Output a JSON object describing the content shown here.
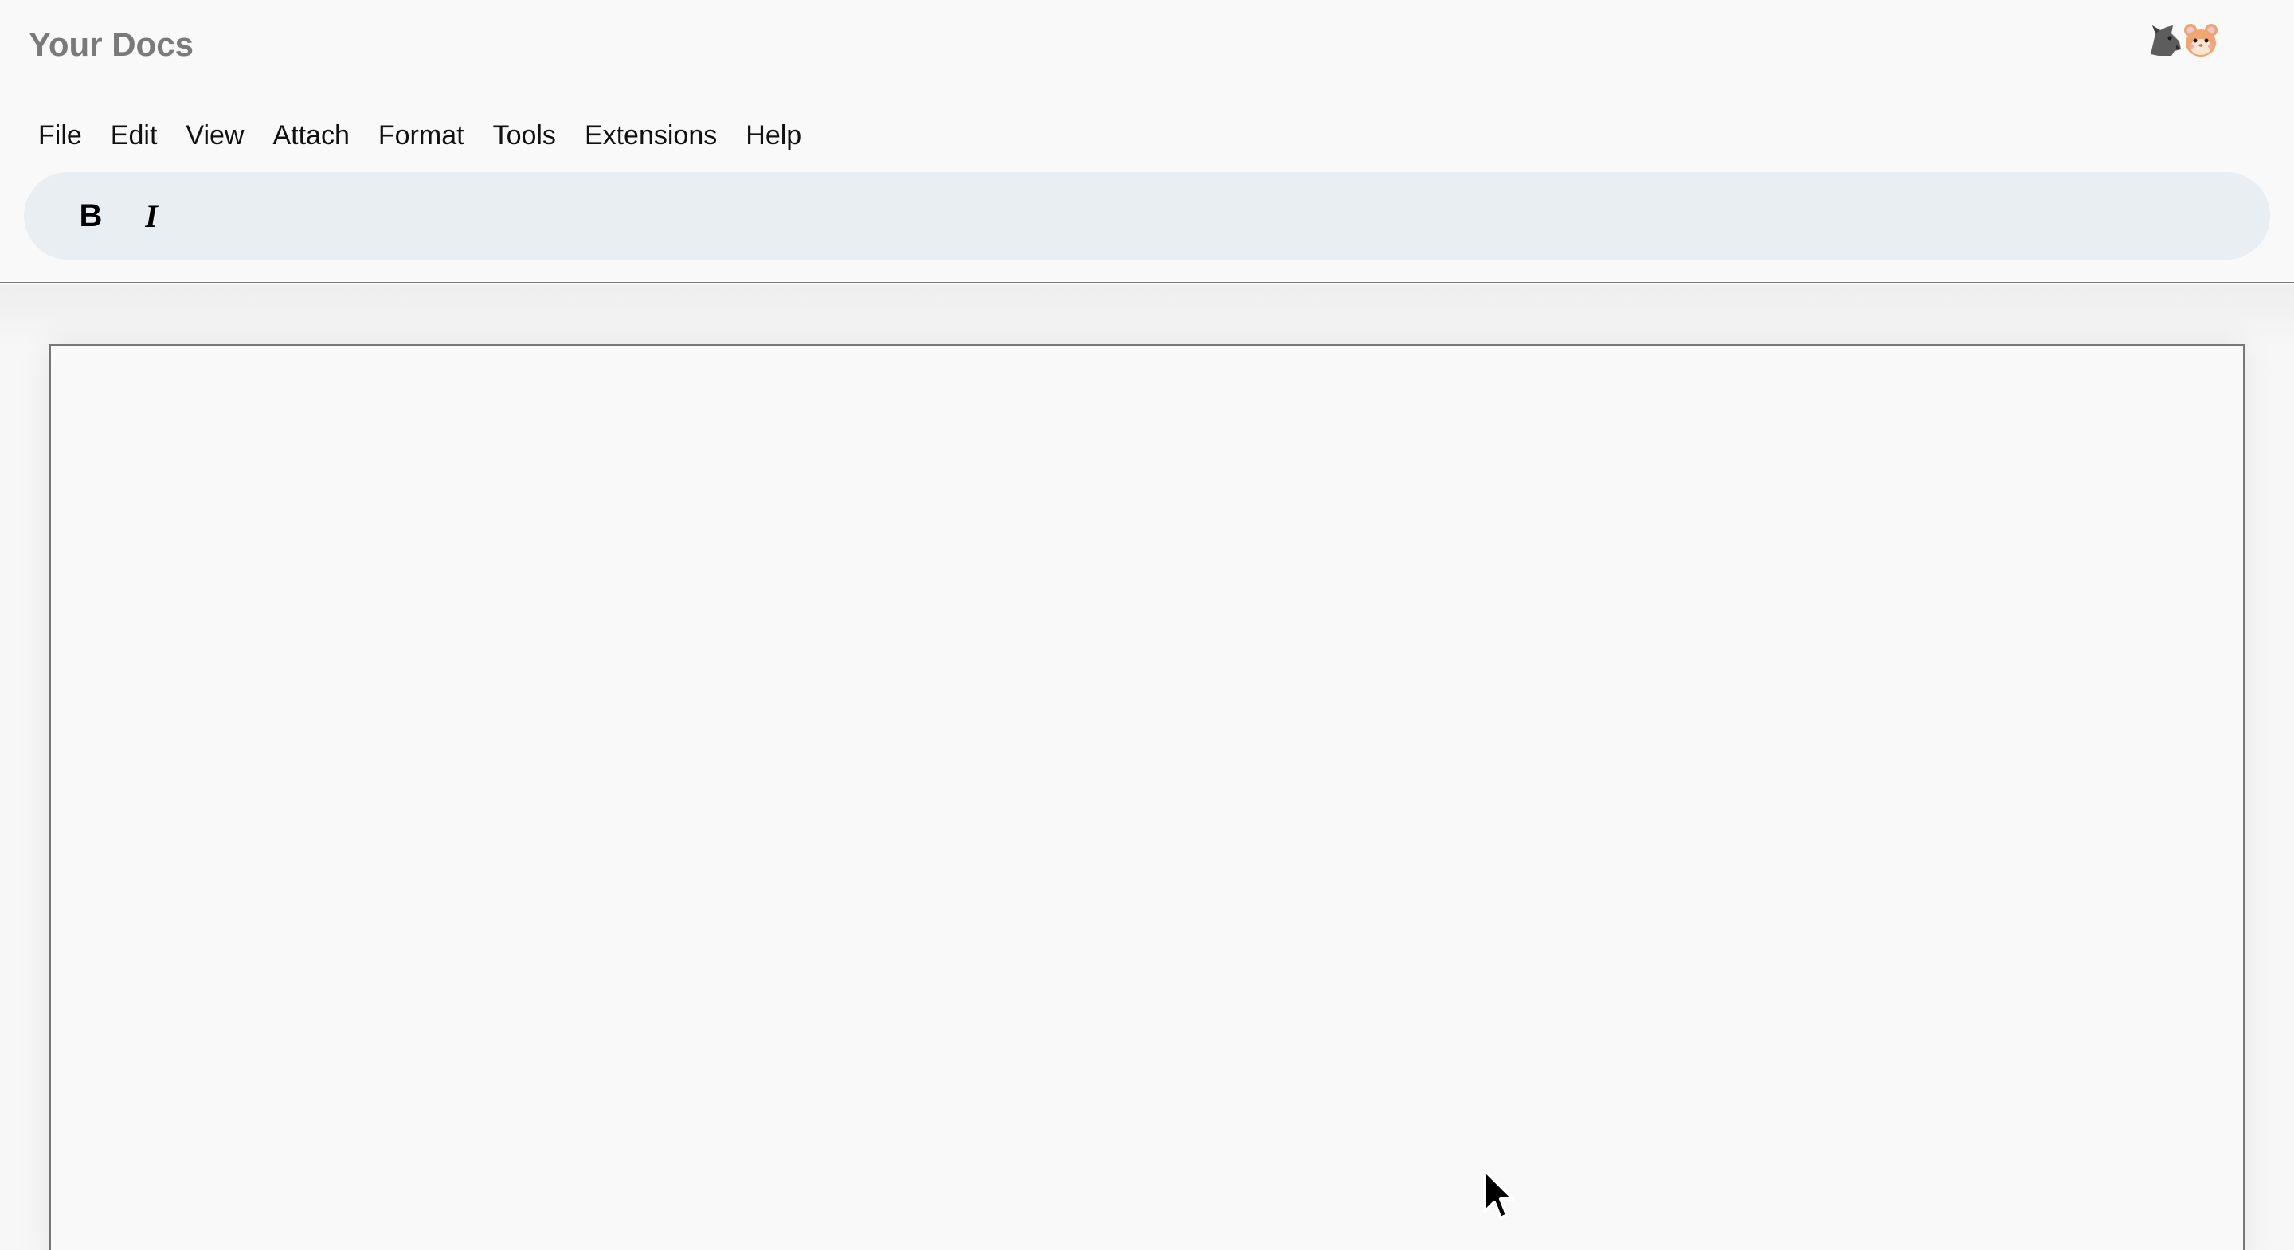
{
  "app": {
    "title": "Your Docs"
  },
  "collaborators": [
    {
      "name": "wolf-avatar",
      "icon": "wolf-icon"
    },
    {
      "name": "hamster-avatar",
      "icon": "hamster-icon"
    }
  ],
  "menubar": {
    "items": [
      "File",
      "Edit",
      "View",
      "Attach",
      "Format",
      "Tools",
      "Extensions",
      "Help"
    ]
  },
  "toolbar": {
    "bold_label": "B",
    "italic_label": "I"
  },
  "document": {
    "content": ""
  },
  "colors": {
    "toolbar_bg": "#e9eef3",
    "title": "#7a7a7a",
    "page_bg": "#f7f7f7"
  }
}
